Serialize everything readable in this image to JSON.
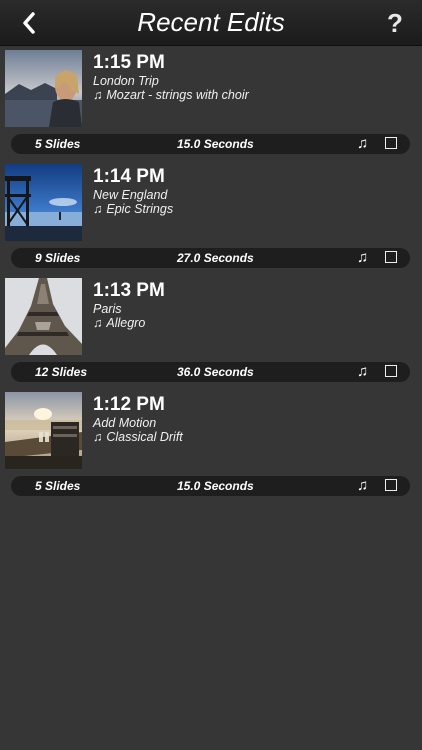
{
  "header": {
    "title": "Recent Edits",
    "help_label": "?"
  },
  "edits": [
    {
      "time": "1:15 PM",
      "name": "London Trip",
      "music": "Mozart - strings with choir",
      "slides": "5 Slides",
      "duration": "15.0 Seconds"
    },
    {
      "time": "1:14 PM",
      "name": "New England",
      "music": "Epic Strings",
      "slides": "9 Slides",
      "duration": "27.0 Seconds"
    },
    {
      "time": "1:13 PM",
      "name": "Paris",
      "music": "Allegro",
      "slides": "12 Slides",
      "duration": "36.0 Seconds"
    },
    {
      "time": "1:12 PM",
      "name": "Add Motion",
      "music": "Classical Drift",
      "slides": "5 Slides",
      "duration": "15.0 Seconds"
    }
  ],
  "icons": {
    "back": "chevron-left-icon",
    "help": "question-mark-icon",
    "note": "music-note-icon",
    "checkbox": "checkbox-icon"
  },
  "colors": {
    "background": "#363636",
    "topbar": "#1b1b1b",
    "bar": "#1e1e1e"
  }
}
